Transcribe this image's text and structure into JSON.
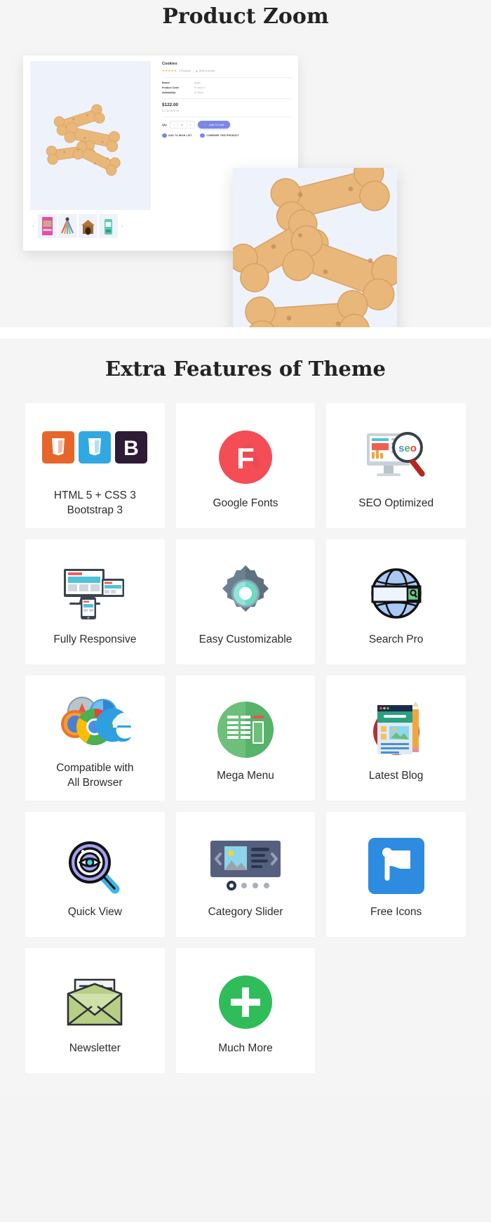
{
  "sections": {
    "product_zoom": {
      "title": "Product Zoom",
      "product": {
        "name": "Cookies",
        "stars": "★★★★★",
        "reviews": "0 Reviews",
        "separator": "|",
        "write_review": "Write a review",
        "specs": [
          {
            "key": "Brand:",
            "value": "Apple"
          },
          {
            "key": "Product Code:",
            "value": "Product 5"
          },
          {
            "key": "Availability:",
            "value": "In Stock"
          }
        ],
        "price": "$122.00",
        "ex_tax": "Ex Tax: $100.00",
        "qty_label": "Qty",
        "qty_minus": "−",
        "qty_value": "1",
        "qty_plus": "+",
        "add_to_cart": "Add To Cart",
        "add_to_wishlist": "ADD TO WISH LIST",
        "compare": "COMPARE THIS PRODUCT",
        "thumb_prev": "‹",
        "thumb_next": "›"
      }
    },
    "features": {
      "title": "Extra Features of Theme",
      "cards": [
        {
          "label": "HTML 5 + CSS 3\nBootstrap 3",
          "icon": "html5-css3-bootstrap-icon"
        },
        {
          "label": "Google Fonts",
          "icon": "google-fonts-icon"
        },
        {
          "label": "SEO Optimized",
          "icon": "seo-optimized-icon"
        },
        {
          "label": "Fully Responsive",
          "icon": "responsive-devices-icon"
        },
        {
          "label": "Easy Customizable",
          "icon": "gear-icon"
        },
        {
          "label": "Search Pro",
          "icon": "globe-search-icon"
        },
        {
          "label": "Compatible with\nAll Browser",
          "icon": "browsers-icon"
        },
        {
          "label": "Mega Menu",
          "icon": "mega-menu-icon"
        },
        {
          "label": "Latest Blog",
          "icon": "latest-blog-icon"
        },
        {
          "label": "Quick View",
          "icon": "quick-view-icon"
        },
        {
          "label": "Category Slider",
          "icon": "category-slider-icon"
        },
        {
          "label": "Free Icons",
          "icon": "flag-icon"
        },
        {
          "label": "Newsletter",
          "icon": "newsletter-envelope-icon"
        },
        {
          "label": "Much More",
          "icon": "plus-circle-icon"
        }
      ]
    }
  },
  "colors": {
    "page_bg": "#f5f5f5",
    "card_bg": "#ffffff",
    "heading": "#232323",
    "accent_purple": "#7b86e8",
    "html5_orange": "#e8652a",
    "css3_blue": "#31a9e0",
    "bootstrap_dark": "#2e1b35",
    "google_fonts_red": "#f44d55",
    "green": "#2ebd59",
    "mega_menu_green": "#57b963",
    "flag_blue": "#2d8ce0",
    "image_bg": "#eef2fb"
  }
}
